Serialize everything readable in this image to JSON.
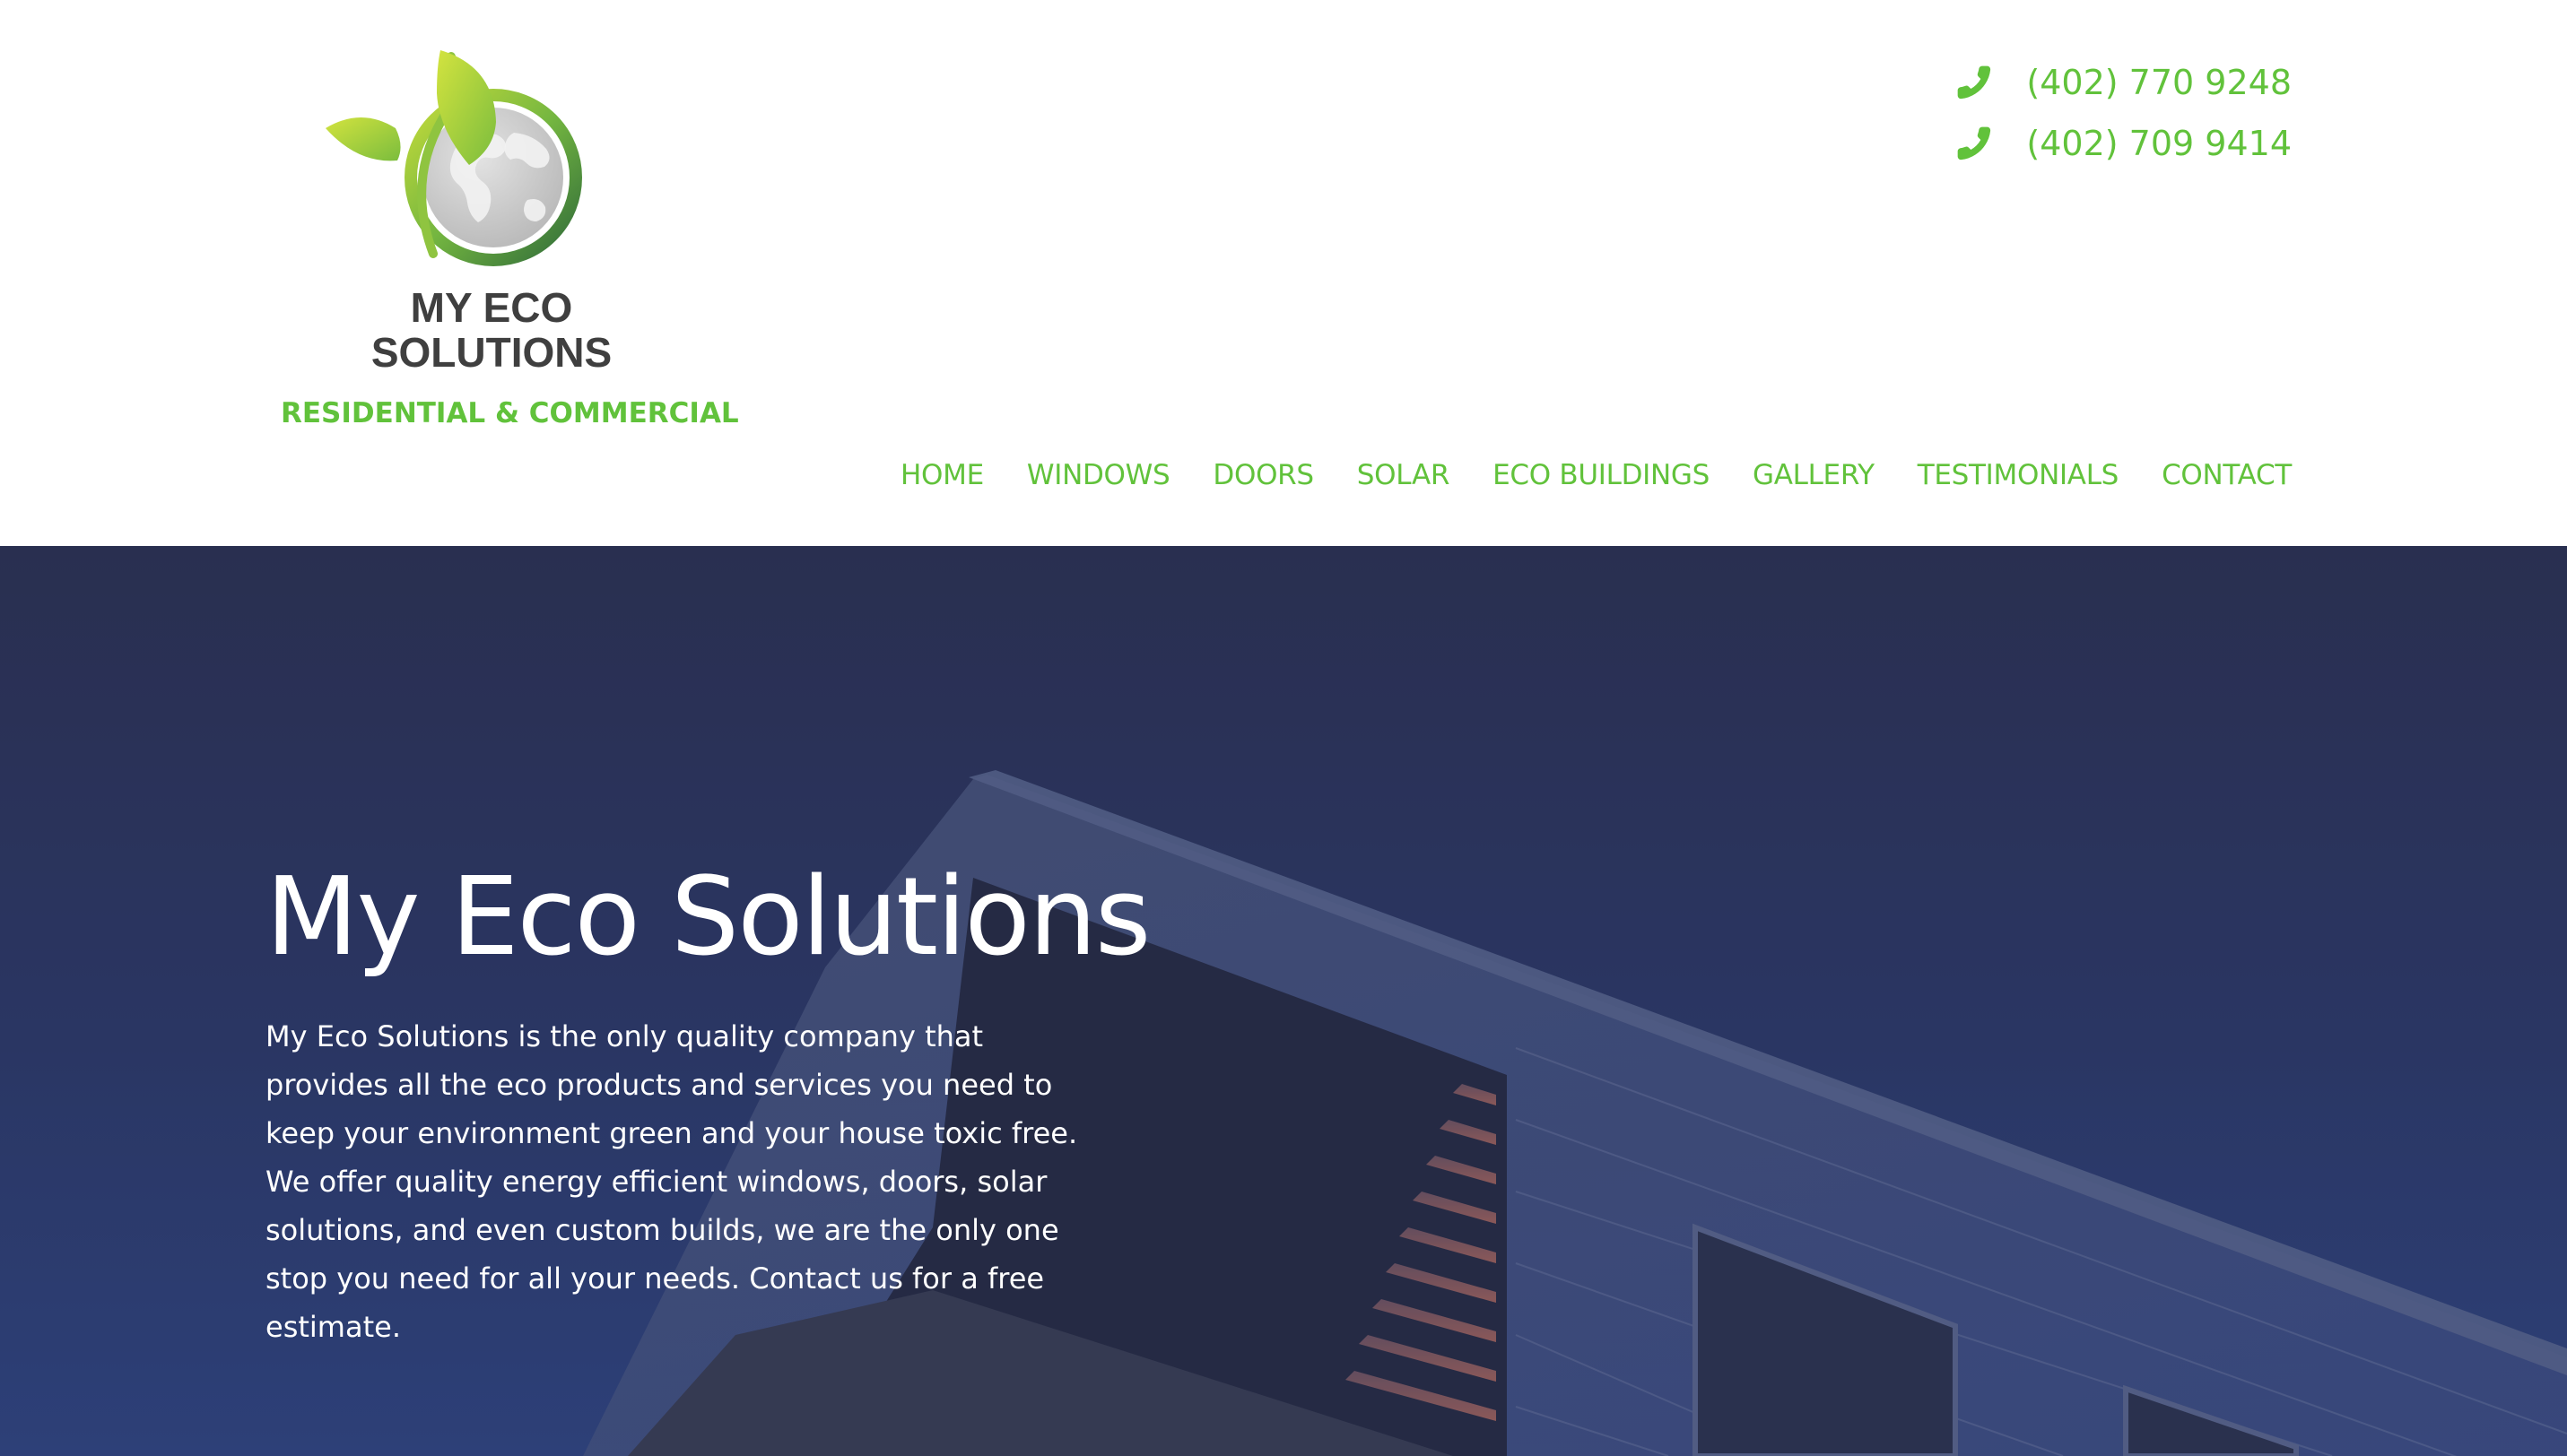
{
  "brand": {
    "name_line1": "MY ECO",
    "name_line2": "SOLUTIONS",
    "tagline": "RESIDENTIAL & COMMERCIAL",
    "logo_icon": "leaf-globe-icon"
  },
  "contact": {
    "phones": [
      "(402) 770 9248",
      "(402) 709 9414"
    ],
    "phone_icon": "phone-icon"
  },
  "nav": {
    "items": [
      "HOME",
      "WINDOWS",
      "DOORS",
      "SOLAR",
      "ECO BUILDINGS",
      "GALLERY",
      "TESTIMONIALS",
      "CONTACT"
    ]
  },
  "hero": {
    "title": "My Eco Solutions",
    "body": "My Eco Solutions is the only quality company that provides all the eco products and services you need to keep your environment green and your house toxic free. We offer quality energy efficient windows, doors, solar solutions, and even custom builds, we are the only one stop you need for all your needs. Contact us for a free estimate."
  },
  "colors": {
    "accent_green": "#61c23b",
    "hero_navy": "#2d3a6a",
    "logo_text_gray": "#3f3f3f"
  }
}
